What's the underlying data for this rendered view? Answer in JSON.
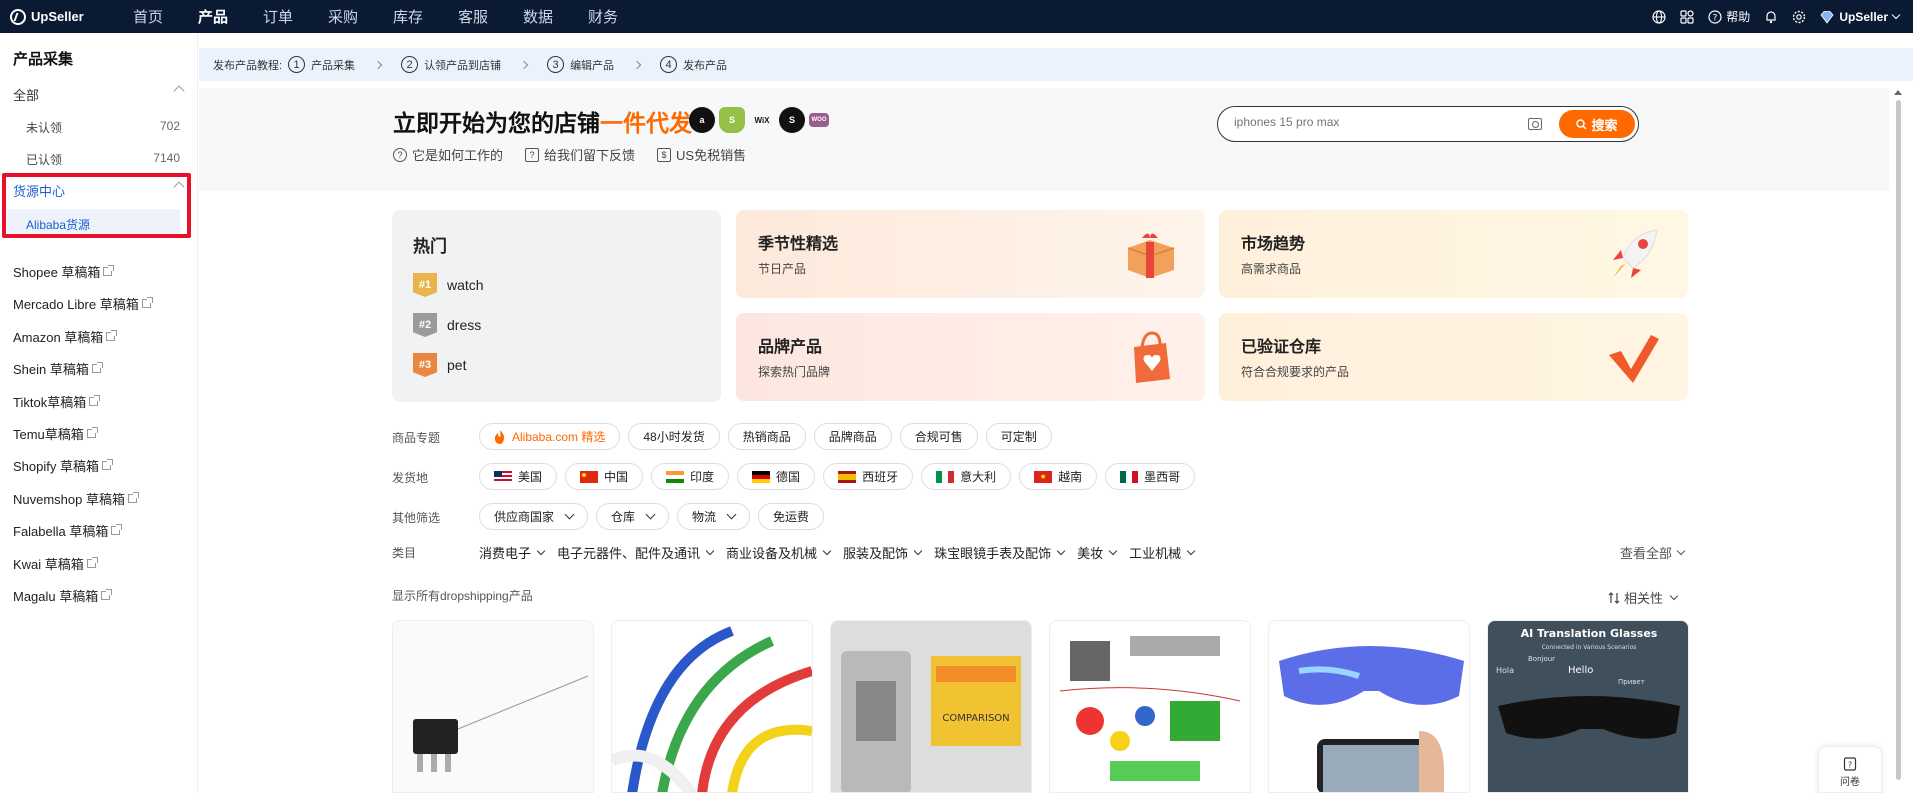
{
  "topbar": {
    "brand": "UpSeller",
    "nav": [
      "首页",
      "产品",
      "订单",
      "采购",
      "库存",
      "客服",
      "数据",
      "财务"
    ],
    "help": "帮助",
    "user": "UpSeller"
  },
  "sidebar": {
    "title": "产品采集",
    "all": "全部",
    "unclaimed": {
      "label": "未认领",
      "count": "702"
    },
    "claimed": {
      "label": "已认领",
      "count": "7140"
    },
    "source_center": "货源中心",
    "alibaba": "Alibaba货源",
    "sources": [
      "Shopee 草稿箱",
      "Mercado Libre 草稿箱",
      "Amazon 草稿箱",
      "Shein 草稿箱",
      "Tiktok草稿箱",
      "Temu草稿箱",
      "Shopify 草稿箱",
      "Nuvemshop 草稿箱",
      "Falabella 草稿箱",
      "Kwai 草稿箱",
      "Magalu 草稿箱"
    ]
  },
  "steps": {
    "label": "发布产品教程:",
    "items": [
      {
        "num": "1",
        "text": "产品采集"
      },
      {
        "num": "2",
        "text": "认领产品到店铺"
      },
      {
        "num": "3",
        "text": "编辑产品"
      },
      {
        "num": "4",
        "text": "发布产品"
      }
    ]
  },
  "hero": {
    "title_main": "立即开始为您的店铺",
    "title_accent": "一件代发",
    "platform_logos": [
      "a",
      "S",
      "WiX",
      "S",
      "WOO"
    ],
    "links": [
      "它是如何工作的",
      "给我们留下反馈",
      "US免税销售"
    ],
    "search_placeholder": "iphones 15 pro max",
    "search_button": "搜索"
  },
  "hot": {
    "title": "热门",
    "items": [
      {
        "rank": "#1",
        "text": "watch"
      },
      {
        "rank": "#2",
        "text": "dress"
      },
      {
        "rank": "#3",
        "text": "pet"
      }
    ]
  },
  "cards": {
    "seasonal": {
      "title": "季节性精选",
      "sub": "节日产品"
    },
    "trend": {
      "title": "市场趋势",
      "sub": "高需求商品"
    },
    "brand": {
      "title": "品牌产品",
      "sub": "探索热门品牌"
    },
    "warehouse": {
      "title": "已验证仓库",
      "sub": "符合合规要求的产品"
    }
  },
  "filters": {
    "topic_label": "商品专题",
    "topics": [
      "Alibaba.com 精选",
      "48小时发货",
      "热销商品",
      "品牌商品",
      "合规可售",
      "可定制"
    ],
    "ship_label": "发货地",
    "countries": [
      "美国",
      "中国",
      "印度",
      "德国",
      "西班牙",
      "意大利",
      "越南",
      "墨西哥"
    ],
    "other_label": "其他筛选",
    "others": [
      "供应商国家",
      "仓库",
      "物流",
      "免运费"
    ],
    "category_label": "类目",
    "categories": [
      "消费电子",
      "电子元器件、配件及通讯",
      "商业设备及机械",
      "服装及配饰",
      "珠宝眼镜手表及配饰",
      "美妆",
      "工业机械"
    ],
    "see_all": "查看全部"
  },
  "list": {
    "show_all": "显示所有dropshipping产品",
    "sort": "相关性"
  },
  "products": {
    "glasses_title": "AI Translation Glasses",
    "glasses_sub": "Connected in Various Scenarios",
    "words": [
      "Hola",
      "Hello",
      "Bonjour",
      "Привет"
    ]
  },
  "float": {
    "label": "问卷"
  }
}
